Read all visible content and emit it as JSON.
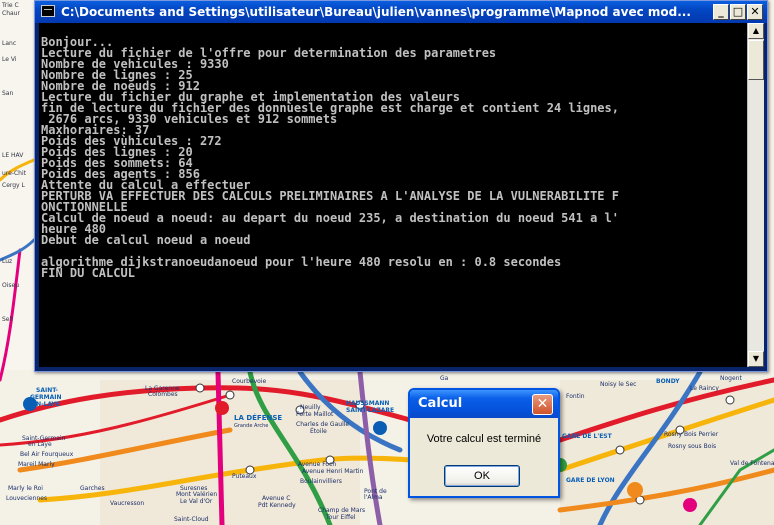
{
  "console": {
    "title": "C:\\Documents and Settings\\utilisateur\\Bureau\\julien\\vannes\\programme\\Mapnod avec mod...",
    "lines": [
      "Bonjour...",
      "Lecture du fichier de l'offre pour determination des parametres",
      "Nombre de vehicules : 9330",
      "Nombre de lignes : 25",
      "Nombre de noeuds : 912",
      "Lecture du fichier du graphe et implementation des valeurs",
      "fin de lecture du fichier des donnùesle graphe est charge et contient 24 lignes,",
      " 2676 arcs, 9330 vehicules et 912 sommets",
      "Maxhoraires: 37",
      "Poids des vùhicules : 272",
      "Poids des lignes : 20",
      "Poids des sommets: 64",
      "Poids des agents : 856",
      "Attente du calcul a effectuer",
      "PERTURB VA EFFECTUER DES CALCULS PRELIMINAIRES A L'ANALYSE DE LA VULNERABILITE F",
      "ONCTIONNELLE",
      "Calcul de noeud a noeud: au depart du noeud 235, a destination du noeud 541 a l'",
      "heure 480",
      "Debut de calcul noeud a noeud",
      "",
      "algorithme dijkstranoeudanoeud pour l'heure 480 resolu en : 0.8 secondes",
      "FIN DU CALCUL"
    ],
    "minimize_label": "_",
    "maximize_label": "□",
    "close_label": "✕",
    "scroll_up": "▲",
    "scroll_down": "▼"
  },
  "dialog": {
    "title": "Calcul",
    "message": "Votre calcul est terminé",
    "ok_label": "OK",
    "close_label": "✕"
  },
  "left_strip": {
    "labels": [
      "Trie C",
      "Chaur",
      "Lanc",
      "Le Vi",
      "San",
      "LE HAV",
      "ure-Chit",
      "Cergy L",
      "Luz",
      "Oiseu",
      "Sell"
    ]
  },
  "map_labels": [
    "SAINT-",
    "GERMAIN",
    "EN-LAYE",
    "La Garenne",
    "Colombes",
    "Courbevoie",
    "LA DÉFENSE",
    "Grande Arche",
    "Neuilly",
    "Porte Maillot",
    "HAUSSMANN",
    "SAINT-LAZARE",
    "Charles de Gaulle",
    "Étoile",
    "Saint-Germain",
    "en Laye",
    "Bel Air Fourqueux",
    "Mareil Marly",
    "Avenue Foch",
    "Avenue Henri Martin",
    "Boulainvilliers",
    "Puteaux",
    "Suresnes",
    "Mont Valérien",
    "Le Val d'Or",
    "Avenue C",
    "Pdt Kennedy",
    "Pont de l'Alma",
    "Champ de Mars",
    "Tour Eiffel",
    "Saint-Cloud",
    "Marly le Roi",
    "Louveciennes",
    "Garches",
    "Vaucresson",
    "Fontin",
    "Noisy le Sec",
    "BONDY",
    "GARE DE L'EST",
    "GARE DE LYON",
    "Rosny Bois Perrier",
    "Rosny sous Bois",
    "Val de Fontenay",
    "Nogent",
    "Le Raincy",
    "Ga"
  ],
  "colors": {
    "console_bg": "#000000",
    "console_text": "#c0c0c0",
    "titlebar": "#0346c2",
    "dialog_titlebar": "#0553dc"
  }
}
